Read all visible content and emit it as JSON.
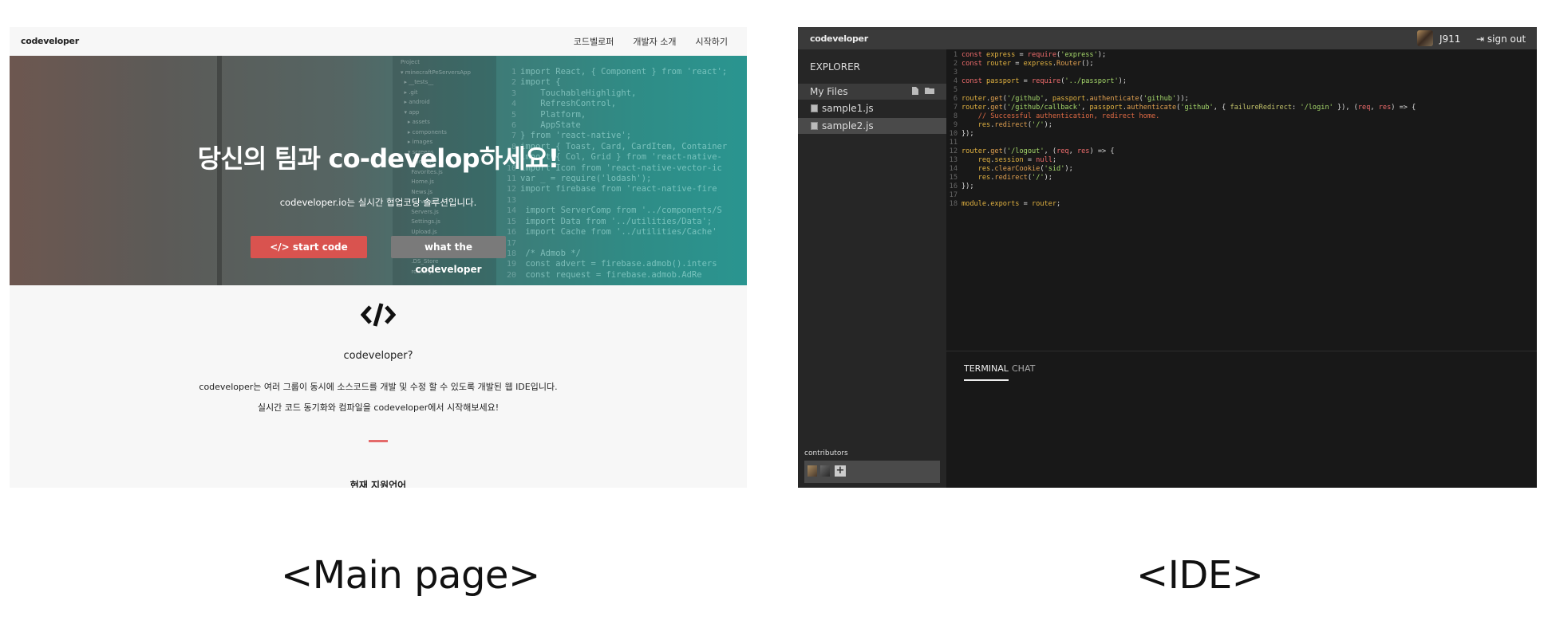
{
  "main_page": {
    "logo": "codeveloper",
    "nav": [
      "코드벨로퍼",
      "개발자 소개",
      "시작하기"
    ],
    "hero": {
      "title": "당신의 팀과 co-develop하세요!",
      "subtitle": "codeveloper.io는 실시간 협업코딩 솔루션입니다.",
      "start_button": "start code",
      "what_button": "what the codeveloper"
    },
    "about": {
      "title": "codeveloper?",
      "desc_line1": "codeveloper는 여러 그룹이 동시에 소스코드를 개발 및 수정 할 수 있도록 개발된 웹 IDE입니다.",
      "desc_line2": "실시간 코드 동기화와 컴파일을 codeveloper에서 시작해보세요!",
      "languages_title": "현재 지원언어"
    }
  },
  "ide": {
    "logo": "codeveloper",
    "user": "J911",
    "signout": "sign out",
    "explorer_label": "EXPLORER",
    "my_files_label": "My Files",
    "files": [
      "sample1.js",
      "sample2.js"
    ],
    "selected_file": "sample2.js",
    "contributors_label": "contributors",
    "tabs": [
      "TERMINAL",
      "CHAT"
    ],
    "active_tab": "TERMINAL",
    "code_lines": [
      {
        "n": "1",
        "t": [
          [
            "k",
            "const "
          ],
          [
            "v",
            "express"
          ],
          [
            "p",
            " = "
          ],
          [
            "k",
            "require"
          ],
          [
            "p",
            "("
          ],
          [
            "s",
            "'express'"
          ],
          [
            "p",
            ");"
          ]
        ]
      },
      {
        "n": "2",
        "t": [
          [
            "k",
            "const "
          ],
          [
            "v",
            "router"
          ],
          [
            "p",
            " = "
          ],
          [
            "v",
            "express"
          ],
          [
            "p",
            "."
          ],
          [
            "f",
            "Router"
          ],
          [
            "p",
            "();"
          ]
        ]
      },
      {
        "n": "3",
        "t": []
      },
      {
        "n": "4",
        "t": [
          [
            "k",
            "const "
          ],
          [
            "v",
            "passport"
          ],
          [
            "p",
            " = "
          ],
          [
            "k",
            "require"
          ],
          [
            "p",
            "("
          ],
          [
            "s",
            "'../passport'"
          ],
          [
            "p",
            ");"
          ]
        ]
      },
      {
        "n": "5",
        "t": []
      },
      {
        "n": "6",
        "t": [
          [
            "v",
            "router"
          ],
          [
            "p",
            "."
          ],
          [
            "f",
            "get"
          ],
          [
            "p",
            "("
          ],
          [
            "s",
            "'/github'"
          ],
          [
            "p",
            ", "
          ],
          [
            "v",
            "passport"
          ],
          [
            "p",
            "."
          ],
          [
            "f",
            "authenticate"
          ],
          [
            "p",
            "("
          ],
          [
            "s",
            "'github'"
          ],
          [
            "p",
            "));"
          ]
        ]
      },
      {
        "n": "7",
        "t": [
          [
            "v",
            "router"
          ],
          [
            "p",
            "."
          ],
          [
            "f",
            "get"
          ],
          [
            "p",
            "("
          ],
          [
            "s",
            "'/github/callback'"
          ],
          [
            "p",
            ", "
          ],
          [
            "v",
            "passport"
          ],
          [
            "p",
            "."
          ],
          [
            "f",
            "authenticate"
          ],
          [
            "p",
            "("
          ],
          [
            "s",
            "'github'"
          ],
          [
            "p",
            ", { "
          ],
          [
            "a",
            "failureRedirect"
          ],
          [
            "p",
            ": "
          ],
          [
            "s",
            "'/login'"
          ],
          [
            "p",
            " }), ("
          ],
          [
            "k",
            "req"
          ],
          [
            "p",
            ", "
          ],
          [
            "k",
            "res"
          ],
          [
            "p",
            ") => {"
          ]
        ]
      },
      {
        "n": "8",
        "t": [
          [
            "c",
            "    // Successful authentication, redirect home."
          ]
        ]
      },
      {
        "n": "9",
        "t": [
          [
            "p",
            "    "
          ],
          [
            "v",
            "res"
          ],
          [
            "p",
            "."
          ],
          [
            "f",
            "redirect"
          ],
          [
            "p",
            "("
          ],
          [
            "s",
            "'/'"
          ],
          [
            "p",
            ");"
          ]
        ]
      },
      {
        "n": "10",
        "t": [
          [
            "p",
            "});"
          ]
        ]
      },
      {
        "n": "11",
        "t": []
      },
      {
        "n": "12",
        "t": [
          [
            "v",
            "router"
          ],
          [
            "p",
            "."
          ],
          [
            "f",
            "get"
          ],
          [
            "p",
            "("
          ],
          [
            "s",
            "'/logout'"
          ],
          [
            "p",
            ", ("
          ],
          [
            "k",
            "req"
          ],
          [
            "p",
            ", "
          ],
          [
            "k",
            "res"
          ],
          [
            "p",
            ") => {"
          ]
        ]
      },
      {
        "n": "13",
        "t": [
          [
            "p",
            "    "
          ],
          [
            "v",
            "req"
          ],
          [
            "p",
            "."
          ],
          [
            "v",
            "session"
          ],
          [
            "p",
            " = "
          ],
          [
            "k",
            "null"
          ],
          [
            "p",
            ";"
          ]
        ]
      },
      {
        "n": "14",
        "t": [
          [
            "p",
            "    "
          ],
          [
            "v",
            "res"
          ],
          [
            "p",
            "."
          ],
          [
            "f",
            "clearCookie"
          ],
          [
            "p",
            "("
          ],
          [
            "s",
            "'sid'"
          ],
          [
            "p",
            ");"
          ]
        ]
      },
      {
        "n": "15",
        "t": [
          [
            "p",
            "    "
          ],
          [
            "v",
            "res"
          ],
          [
            "p",
            "."
          ],
          [
            "f",
            "redirect"
          ],
          [
            "p",
            "("
          ],
          [
            "s",
            "'/'"
          ],
          [
            "p",
            ");"
          ]
        ]
      },
      {
        "n": "16",
        "t": [
          [
            "p",
            "});"
          ]
        ]
      },
      {
        "n": "17",
        "t": []
      },
      {
        "n": "18",
        "t": [
          [
            "v",
            "module"
          ],
          [
            "p",
            "."
          ],
          [
            "v",
            "exports"
          ],
          [
            "p",
            " = "
          ],
          [
            "v",
            "router"
          ],
          [
            "p",
            ";"
          ]
        ]
      }
    ]
  },
  "captions": {
    "main": "<Main page>",
    "ide": "<IDE>"
  }
}
